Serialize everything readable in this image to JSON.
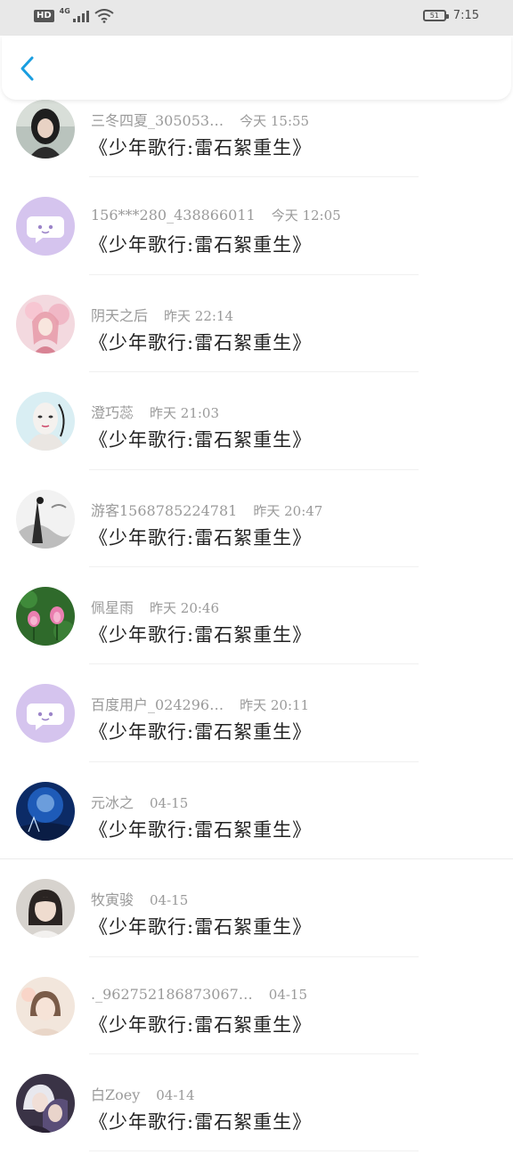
{
  "status_bar": {
    "hd": "HD",
    "network": "4G",
    "battery": "51",
    "time": "7:15"
  },
  "colors": {
    "accent": "#1a9ee0",
    "default_avatar_bg": "#d5c4ee"
  },
  "replies": [
    {
      "user": "三冬四夏_305053…",
      "time": "今天 15:55",
      "title": "《少年歌行:雷石絮重生》",
      "avatar": "photo-girl-dark-hair"
    },
    {
      "user": "156***280_438866011",
      "time": "今天 12:05",
      "title": "《少年歌行:雷石絮重生》",
      "avatar": "default-chat-bubble"
    },
    {
      "user": "阴天之后",
      "time": "昨天 22:14",
      "title": "《少年歌行:雷石絮重生》",
      "avatar": "photo-pink-anime-girl"
    },
    {
      "user": "澄巧蕊",
      "time": "昨天 21:03",
      "title": "《少年歌行:雷石絮重生》",
      "avatar": "photo-white-face"
    },
    {
      "user": "游客1568785224781",
      "time": "昨天 20:47",
      "title": "《少年歌行:雷石絮重生》",
      "avatar": "photo-ink-painting"
    },
    {
      "user": "佩星雨",
      "time": "昨天 20:46",
      "title": "《少年歌行:雷石絮重生》",
      "avatar": "photo-pink-flowers"
    },
    {
      "user": "百度用户_024296…",
      "time": "昨天 20:11",
      "title": "《少年歌行:雷石絮重生》",
      "avatar": "default-chat-bubble"
    },
    {
      "user": "元冰之",
      "time": "04-15",
      "title": "《少年歌行:雷石絮重生》",
      "avatar": "photo-blue-night"
    },
    {
      "user": "牧寅骏",
      "time": "04-15",
      "title": "《少年歌行:雷石絮重生》",
      "avatar": "photo-girl-short-hair"
    },
    {
      "user": "._962752186873067…",
      "time": "04-15",
      "title": "《少年歌行:雷石絮重生》",
      "avatar": "photo-girl-light"
    },
    {
      "user": "白Zoey",
      "time": "04-14",
      "title": "《少年歌行:雷石絮重生》",
      "avatar": "photo-anime-pair"
    }
  ]
}
